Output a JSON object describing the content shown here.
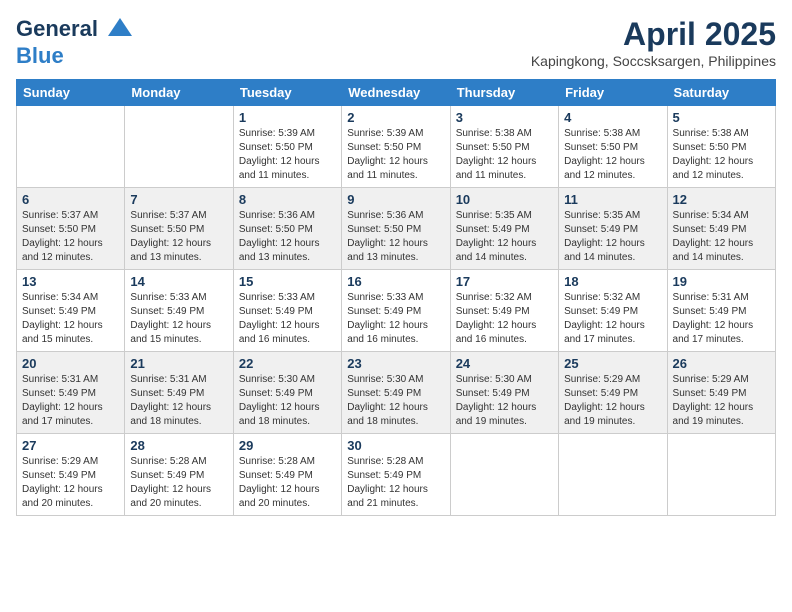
{
  "header": {
    "logo_general": "General",
    "logo_blue": "Blue",
    "month_title": "April 2025",
    "location": "Kapingkong, Soccsksargen, Philippines"
  },
  "weekdays": [
    "Sunday",
    "Monday",
    "Tuesday",
    "Wednesday",
    "Thursday",
    "Friday",
    "Saturday"
  ],
  "weeks": [
    [
      {
        "day": "",
        "info": ""
      },
      {
        "day": "",
        "info": ""
      },
      {
        "day": "1",
        "info": "Sunrise: 5:39 AM\nSunset: 5:50 PM\nDaylight: 12 hours and 11 minutes."
      },
      {
        "day": "2",
        "info": "Sunrise: 5:39 AM\nSunset: 5:50 PM\nDaylight: 12 hours and 11 minutes."
      },
      {
        "day": "3",
        "info": "Sunrise: 5:38 AM\nSunset: 5:50 PM\nDaylight: 12 hours and 11 minutes."
      },
      {
        "day": "4",
        "info": "Sunrise: 5:38 AM\nSunset: 5:50 PM\nDaylight: 12 hours and 12 minutes."
      },
      {
        "day": "5",
        "info": "Sunrise: 5:38 AM\nSunset: 5:50 PM\nDaylight: 12 hours and 12 minutes."
      }
    ],
    [
      {
        "day": "6",
        "info": "Sunrise: 5:37 AM\nSunset: 5:50 PM\nDaylight: 12 hours and 12 minutes."
      },
      {
        "day": "7",
        "info": "Sunrise: 5:37 AM\nSunset: 5:50 PM\nDaylight: 12 hours and 13 minutes."
      },
      {
        "day": "8",
        "info": "Sunrise: 5:36 AM\nSunset: 5:50 PM\nDaylight: 12 hours and 13 minutes."
      },
      {
        "day": "9",
        "info": "Sunrise: 5:36 AM\nSunset: 5:50 PM\nDaylight: 12 hours and 13 minutes."
      },
      {
        "day": "10",
        "info": "Sunrise: 5:35 AM\nSunset: 5:49 PM\nDaylight: 12 hours and 14 minutes."
      },
      {
        "day": "11",
        "info": "Sunrise: 5:35 AM\nSunset: 5:49 PM\nDaylight: 12 hours and 14 minutes."
      },
      {
        "day": "12",
        "info": "Sunrise: 5:34 AM\nSunset: 5:49 PM\nDaylight: 12 hours and 14 minutes."
      }
    ],
    [
      {
        "day": "13",
        "info": "Sunrise: 5:34 AM\nSunset: 5:49 PM\nDaylight: 12 hours and 15 minutes."
      },
      {
        "day": "14",
        "info": "Sunrise: 5:33 AM\nSunset: 5:49 PM\nDaylight: 12 hours and 15 minutes."
      },
      {
        "day": "15",
        "info": "Sunrise: 5:33 AM\nSunset: 5:49 PM\nDaylight: 12 hours and 16 minutes."
      },
      {
        "day": "16",
        "info": "Sunrise: 5:33 AM\nSunset: 5:49 PM\nDaylight: 12 hours and 16 minutes."
      },
      {
        "day": "17",
        "info": "Sunrise: 5:32 AM\nSunset: 5:49 PM\nDaylight: 12 hours and 16 minutes."
      },
      {
        "day": "18",
        "info": "Sunrise: 5:32 AM\nSunset: 5:49 PM\nDaylight: 12 hours and 17 minutes."
      },
      {
        "day": "19",
        "info": "Sunrise: 5:31 AM\nSunset: 5:49 PM\nDaylight: 12 hours and 17 minutes."
      }
    ],
    [
      {
        "day": "20",
        "info": "Sunrise: 5:31 AM\nSunset: 5:49 PM\nDaylight: 12 hours and 17 minutes."
      },
      {
        "day": "21",
        "info": "Sunrise: 5:31 AM\nSunset: 5:49 PM\nDaylight: 12 hours and 18 minutes."
      },
      {
        "day": "22",
        "info": "Sunrise: 5:30 AM\nSunset: 5:49 PM\nDaylight: 12 hours and 18 minutes."
      },
      {
        "day": "23",
        "info": "Sunrise: 5:30 AM\nSunset: 5:49 PM\nDaylight: 12 hours and 18 minutes."
      },
      {
        "day": "24",
        "info": "Sunrise: 5:30 AM\nSunset: 5:49 PM\nDaylight: 12 hours and 19 minutes."
      },
      {
        "day": "25",
        "info": "Sunrise: 5:29 AM\nSunset: 5:49 PM\nDaylight: 12 hours and 19 minutes."
      },
      {
        "day": "26",
        "info": "Sunrise: 5:29 AM\nSunset: 5:49 PM\nDaylight: 12 hours and 19 minutes."
      }
    ],
    [
      {
        "day": "27",
        "info": "Sunrise: 5:29 AM\nSunset: 5:49 PM\nDaylight: 12 hours and 20 minutes."
      },
      {
        "day": "28",
        "info": "Sunrise: 5:28 AM\nSunset: 5:49 PM\nDaylight: 12 hours and 20 minutes."
      },
      {
        "day": "29",
        "info": "Sunrise: 5:28 AM\nSunset: 5:49 PM\nDaylight: 12 hours and 20 minutes."
      },
      {
        "day": "30",
        "info": "Sunrise: 5:28 AM\nSunset: 5:49 PM\nDaylight: 12 hours and 21 minutes."
      },
      {
        "day": "",
        "info": ""
      },
      {
        "day": "",
        "info": ""
      },
      {
        "day": "",
        "info": ""
      }
    ]
  ]
}
